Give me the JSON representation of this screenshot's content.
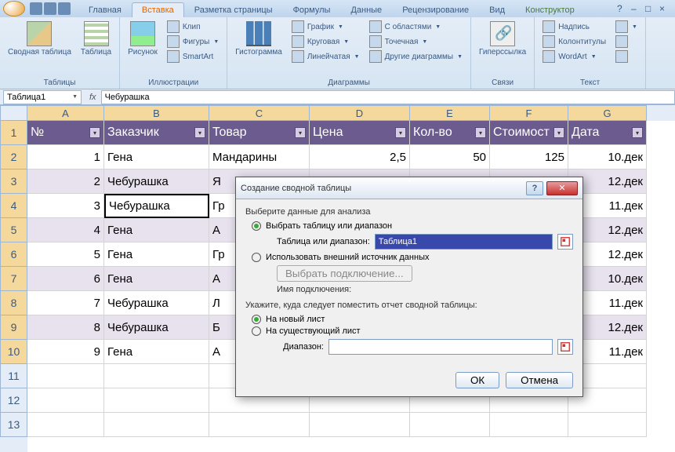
{
  "tabs": [
    "Главная",
    "Вставка",
    "Разметка страницы",
    "Формулы",
    "Данные",
    "Рецензирование",
    "Вид",
    "Конструктор"
  ],
  "active_tab": "Вставка",
  "ribbon": {
    "groups": {
      "tables": {
        "label": "Таблицы",
        "pivot": "Сводная таблица",
        "table": "Таблица"
      },
      "illustrations": {
        "label": "Иллюстрации",
        "picture": "Рисунок",
        "clip": "Клип",
        "shapes": "Фигуры",
        "smartart": "SmartArt"
      },
      "charts": {
        "label": "Диаграммы",
        "histogram": "Гистограмма",
        "line": "График",
        "pie": "Круговая",
        "bar": "Линейчатая",
        "area": "С областями",
        "scatter": "Точечная",
        "other": "Другие диаграммы"
      },
      "links": {
        "label": "Связи",
        "hyperlink": "Гиперссылка"
      },
      "text": {
        "label": "Текст",
        "textbox": "Надпись",
        "headerfooter": "Колонтитулы",
        "wordart": "WordArt"
      }
    }
  },
  "name_box": "Таблица1",
  "fx": "fx",
  "formula": "Чебурашка",
  "columns": [
    "A",
    "B",
    "C",
    "D",
    "E",
    "F",
    "G"
  ],
  "row_numbers": [
    1,
    2,
    3,
    4,
    5,
    6,
    7,
    8,
    9,
    10,
    11,
    12,
    13
  ],
  "headers": [
    "№",
    "Заказчик",
    "Товар",
    "Цена",
    "Кол-во",
    "Стоимост",
    "Дата"
  ],
  "rows": [
    {
      "n": "1",
      "cust": "Гена",
      "prod": "Мандарины",
      "price": "2,5",
      "qty": "50",
      "cost": "125",
      "date": "10.дек"
    },
    {
      "n": "2",
      "cust": "Чебурашка",
      "prod": "Я",
      "price": "",
      "qty": "",
      "cost": "",
      "date": "12.дек"
    },
    {
      "n": "3",
      "cust": "Чебурашка",
      "prod": "Гр",
      "price": "",
      "qty": "",
      "cost": "",
      "date": "11.дек"
    },
    {
      "n": "4",
      "cust": "Гена",
      "prod": "А",
      "price": "",
      "qty": "",
      "cost": "",
      "date": "12.дек"
    },
    {
      "n": "5",
      "cust": "Гена",
      "prod": "Гр",
      "price": "",
      "qty": "",
      "cost": "",
      "date": "12.дек"
    },
    {
      "n": "6",
      "cust": "Гена",
      "prod": "А",
      "price": "",
      "qty": "",
      "cost": "",
      "date": "10.дек"
    },
    {
      "n": "7",
      "cust": "Чебурашка",
      "prod": "Л",
      "price": "",
      "qty": "",
      "cost": "",
      "date": "11.дек"
    },
    {
      "n": "8",
      "cust": "Чебурашка",
      "prod": "Б",
      "price": "",
      "qty": "",
      "cost": "",
      "date": "12.дек"
    },
    {
      "n": "9",
      "cust": "Гена",
      "prod": "А",
      "price": "",
      "qty": "",
      "cost": "",
      "date": "11.дек"
    }
  ],
  "selected_cell": {
    "r": 4,
    "c": "B"
  },
  "dialog": {
    "title": "Создание сводной таблицы",
    "analyze_label": "Выберите данные для анализа",
    "opt_range": "Выбрать таблицу или диапазон",
    "range_label": "Таблица или диапазон:",
    "range_value": "Таблица1",
    "opt_external": "Использовать внешний источник данных",
    "choose_conn": "Выбрать подключение...",
    "conn_name": "Имя подключения:",
    "place_label": "Укажите, куда следует поместить отчет сводной таблицы:",
    "opt_newsheet": "На новый лист",
    "opt_existing": "На существующий лист",
    "loc_label": "Диапазон:",
    "loc_value": "",
    "ok": "ОК",
    "cancel": "Отмена"
  }
}
